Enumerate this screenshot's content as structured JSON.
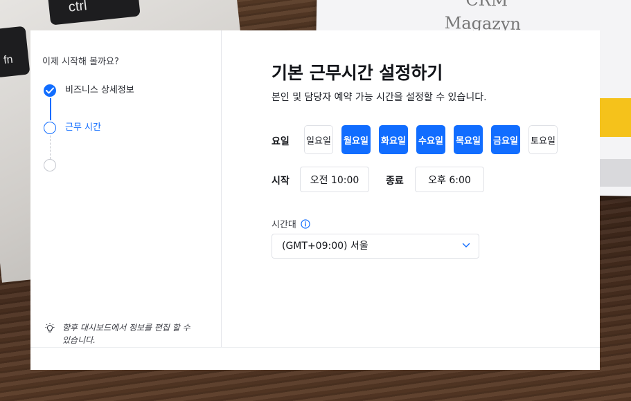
{
  "background": {
    "key_ctrl": "ctrl",
    "key_fn": "fn",
    "paper_line1": "CRM",
    "paper_line2": "Magazyn"
  },
  "colors": {
    "accent": "#116dff",
    "text_dark": "#111318",
    "border": "#dfe1e6"
  },
  "sidebar": {
    "title": "이제 시작해 볼까요?",
    "steps": [
      {
        "label": "비즈니스 상세정보",
        "state": "done",
        "icon": "check-icon"
      },
      {
        "label": "근무 시간",
        "state": "current"
      },
      {
        "label": "",
        "state": "todo"
      }
    ],
    "hint": {
      "icon": "lightbulb-icon",
      "text": "향후 대시보드에서 정보를 편집 할 수 있습니다."
    }
  },
  "main": {
    "title": "기본 근무시간 설정하기",
    "subtitle": "본인 및 담당자 예약 가능 시간을 설정할 수 있습니다.",
    "days_label": "요일",
    "days": [
      {
        "label": "일요일",
        "selected": false
      },
      {
        "label": "월요일",
        "selected": true
      },
      {
        "label": "화요일",
        "selected": true
      },
      {
        "label": "수요일",
        "selected": true
      },
      {
        "label": "목요일",
        "selected": true
      },
      {
        "label": "금요일",
        "selected": true
      },
      {
        "label": "토요일",
        "selected": false
      }
    ],
    "start_label": "시작",
    "start_value": "오전 10:00",
    "end_label": "종료",
    "end_value": "오후 6:00",
    "timezone_label": "시간대",
    "timezone_value": "(GMT+09:00) 서울"
  }
}
